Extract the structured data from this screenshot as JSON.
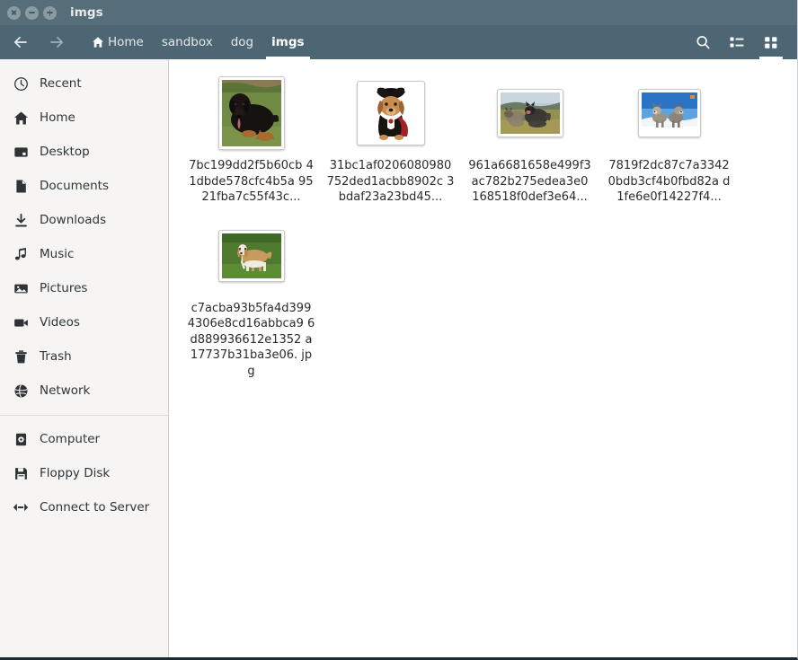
{
  "window": {
    "title": "imgs",
    "controls": [
      {
        "name": "close-button",
        "glyph": "x"
      },
      {
        "name": "minimize-button",
        "glyph": "minus"
      },
      {
        "name": "maximize-button",
        "glyph": "plus"
      }
    ]
  },
  "toolbar": {
    "back_label": "Back",
    "forward_label": "Forward",
    "breadcrumbs": [
      {
        "label": "Home",
        "icon": "home-icon",
        "active": false
      },
      {
        "label": "sandbox",
        "icon": "",
        "active": false
      },
      {
        "label": "dog",
        "icon": "",
        "active": false
      },
      {
        "label": "imgs",
        "icon": "",
        "active": true
      }
    ],
    "actions": [
      {
        "name": "search-button",
        "icon": "search-icon",
        "active": false
      },
      {
        "name": "list-view-button",
        "icon": "list-view-icon",
        "active": false
      },
      {
        "name": "grid-view-button",
        "icon": "grid-view-icon",
        "active": true
      }
    ]
  },
  "sidebar": {
    "groups": [
      {
        "items": [
          {
            "label": "Recent",
            "icon": "clock-icon"
          },
          {
            "label": "Home",
            "icon": "home-icon"
          },
          {
            "label": "Desktop",
            "icon": "desktop-icon"
          },
          {
            "label": "Documents",
            "icon": "document-icon"
          },
          {
            "label": "Downloads",
            "icon": "download-icon"
          },
          {
            "label": "Music",
            "icon": "music-note-icon"
          },
          {
            "label": "Pictures",
            "icon": "picture-icon"
          },
          {
            "label": "Videos",
            "icon": "video-camera-icon"
          },
          {
            "label": "Trash",
            "icon": "trash-icon"
          },
          {
            "label": "Network",
            "icon": "globe-icon"
          }
        ]
      },
      {
        "items": [
          {
            "label": "Computer",
            "icon": "harddisk-icon"
          },
          {
            "label": "Floppy Disk",
            "icon": "floppy-icon"
          },
          {
            "label": "Connect to Server",
            "icon": "connect-server-icon"
          }
        ]
      }
    ]
  },
  "files": [
    {
      "name_lines": [
        "7bc199dd2f5b60cb",
        "41dbde578cfc4b5a",
        "9521fba7c55f43c..."
      ],
      "thumb": "dog-black-tan-on-grass",
      "thumb_w": 66,
      "thumb_h": 74
    },
    {
      "name_lines": [
        "31bc1af0206080980",
        "752ded1acbb8902c",
        "3bdaf23a23bd45..."
      ],
      "thumb": "dog-vampire-costume",
      "thumb_w": 68,
      "thumb_h": 64
    },
    {
      "name_lines": [
        "961a6681658e499f3",
        "ac782b275edea3e0",
        "168518f0def3e64..."
      ],
      "thumb": "two-shepherd-dogs-field",
      "thumb_w": 66,
      "thumb_h": 46
    },
    {
      "name_lines": [
        "7819f2dc87c7a3342",
        "0bdb3cf4b0fbd82a",
        "d1fe6e0f14227f4..."
      ],
      "thumb": "two-wolves-in-snow",
      "thumb_w": 62,
      "thumb_h": 46
    },
    {
      "name_lines": [
        "c7acba93b5fa4d399",
        "4306e8cd16abbca9",
        "6d889936612e1352",
        "a17737b31ba3e06.",
        "jpg"
      ],
      "thumb": "tan-white-dog-on-grass",
      "thumb_w": 66,
      "thumb_h": 50
    }
  ],
  "colors": {
    "titlebar": "#556e7a",
    "toolbar": "#4d6673",
    "sidebar": "#f6f5f4",
    "content": "#ffffff",
    "text": "#2f3437"
  }
}
